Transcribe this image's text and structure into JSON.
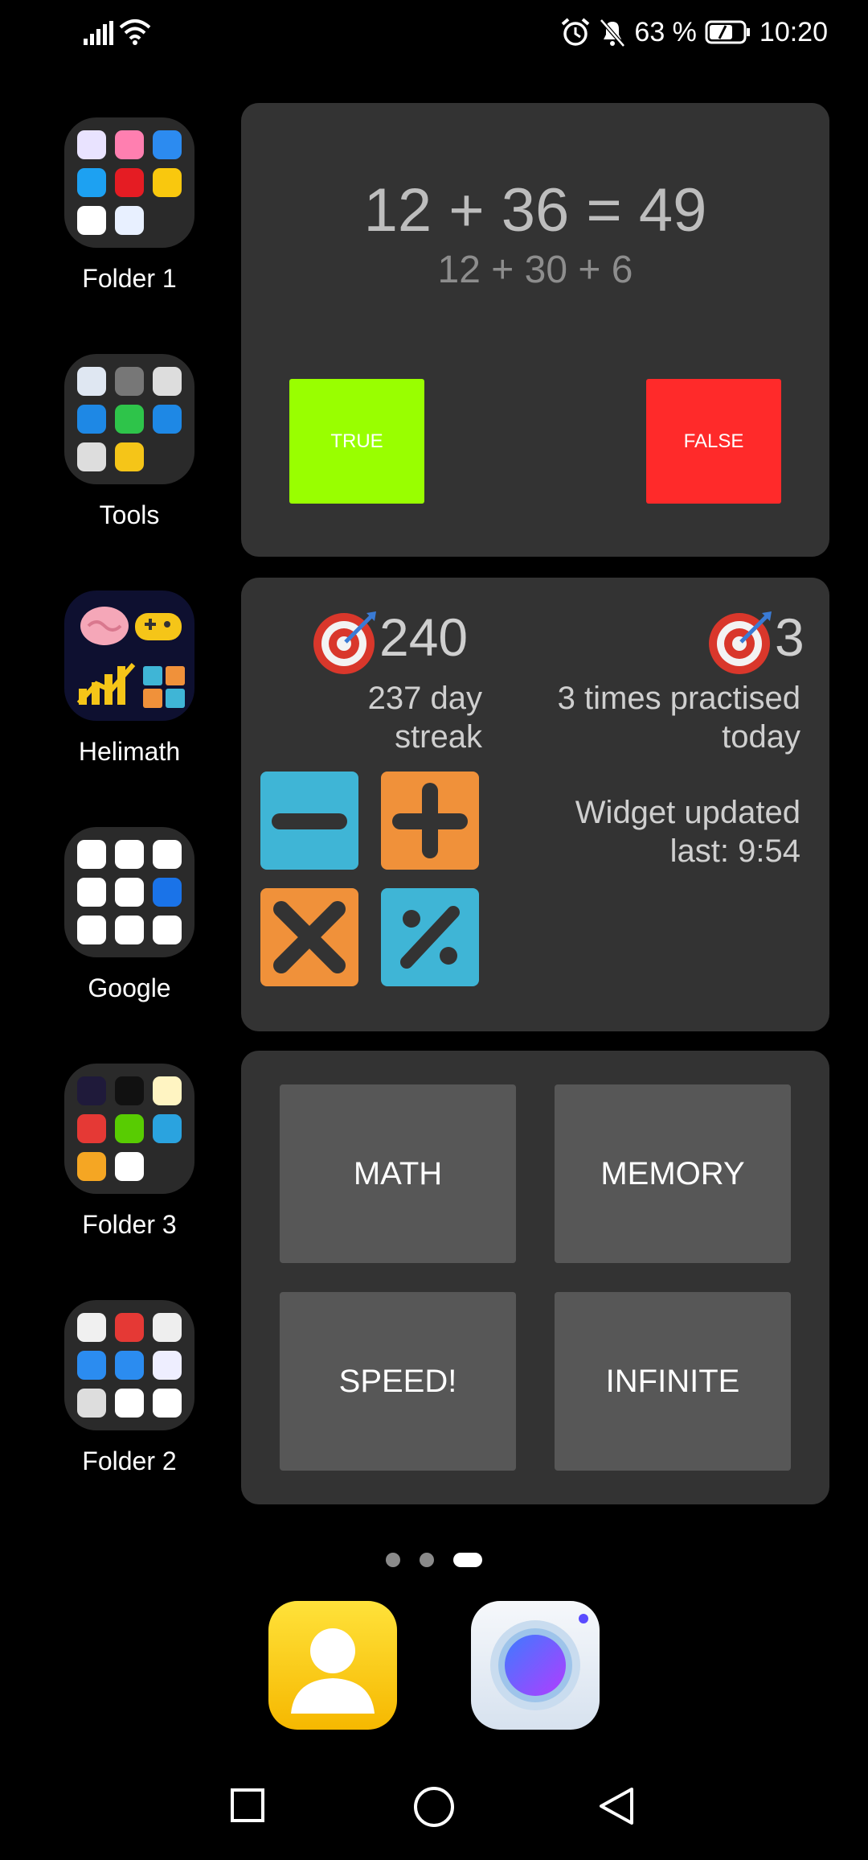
{
  "status_bar": {
    "battery": "63 %",
    "time": "10:20"
  },
  "folders": [
    {
      "label": "Folder 1"
    },
    {
      "label": "Tools"
    },
    {
      "label": "Helimath"
    },
    {
      "label": "Google"
    },
    {
      "label": "Folder 3"
    },
    {
      "label": "Folder 2"
    }
  ],
  "quiz_widget": {
    "equation": "12 + 36 = 49",
    "hint": "12 + 30 + 6",
    "true_label": "TRUE",
    "false_label": "FALSE"
  },
  "stats_widget": {
    "streak_number": "240",
    "streak_text_1": "237 day",
    "streak_text_2": "streak",
    "practice_number": "3",
    "practice_text_1": "3 times practised",
    "practice_text_2": "today",
    "updated_text_1": "Widget updated",
    "updated_text_2": "last: 9:54"
  },
  "modes_widget": {
    "math": "MATH",
    "memory": "MEMORY",
    "speed": "SPEED!",
    "infinite": "INFINITE"
  },
  "colors": {
    "true_green": "#99ff00",
    "false_red": "#ff2a2a",
    "tile_blue": "#3fb5d6",
    "tile_orange": "#f0913a",
    "widget_bg": "#333333"
  },
  "page_indicator": {
    "count": 3,
    "active": 3
  }
}
